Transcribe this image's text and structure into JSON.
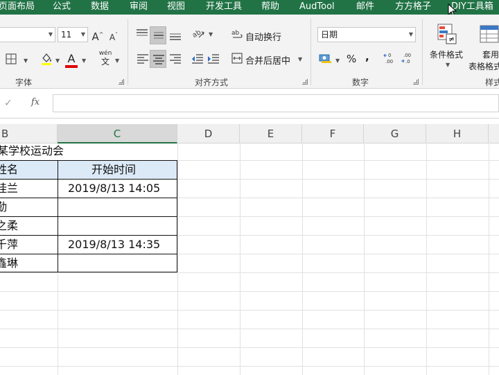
{
  "menu": {
    "items": [
      "页面布局",
      "公式",
      "数据",
      "审阅",
      "视图",
      "开发工具",
      "帮助",
      "AudTool",
      "邮件",
      "方方格子",
      "DIY工具箱"
    ]
  },
  "ribbon": {
    "font_group": {
      "font_size": "11",
      "grow_font": "A",
      "shrink_font": "A",
      "wen_label": "wén",
      "wen_char": "文",
      "font_color_letter": "A",
      "label": "字体"
    },
    "align_group": {
      "wrap_text": "自动换行",
      "merge_center": "合并后居中",
      "label": "对齐方式"
    },
    "number_group": {
      "format": "日期",
      "percent": "%",
      "comma": ",",
      "label": "数字"
    },
    "styles_group": {
      "conditional_format": "条件格式",
      "format_as_table_1": "套用",
      "format_as_table_2": "表格格式",
      "label": "样式"
    }
  },
  "formula_bar": {
    "enter_symbol": "✓",
    "fx": "fx",
    "value": ""
  },
  "sheet": {
    "columns": [
      "B",
      "C",
      "D",
      "E",
      "F",
      "G",
      "H"
    ],
    "selected_column": "C",
    "title": "某学校运动会",
    "header": {
      "name": "姓名",
      "start_time": "开始时间"
    },
    "rows": [
      {
        "name": "桂兰",
        "start_time": "2019/8/13 14:05"
      },
      {
        "name": "勤",
        "start_time": ""
      },
      {
        "name": "之柔",
        "start_time": ""
      },
      {
        "name": "千萍",
        "start_time": "2019/8/13 14:35"
      },
      {
        "name": "鑫琳",
        "start_time": ""
      }
    ]
  },
  "colors": {
    "brand": "#217346",
    "header_fill": "#dce9f7"
  }
}
